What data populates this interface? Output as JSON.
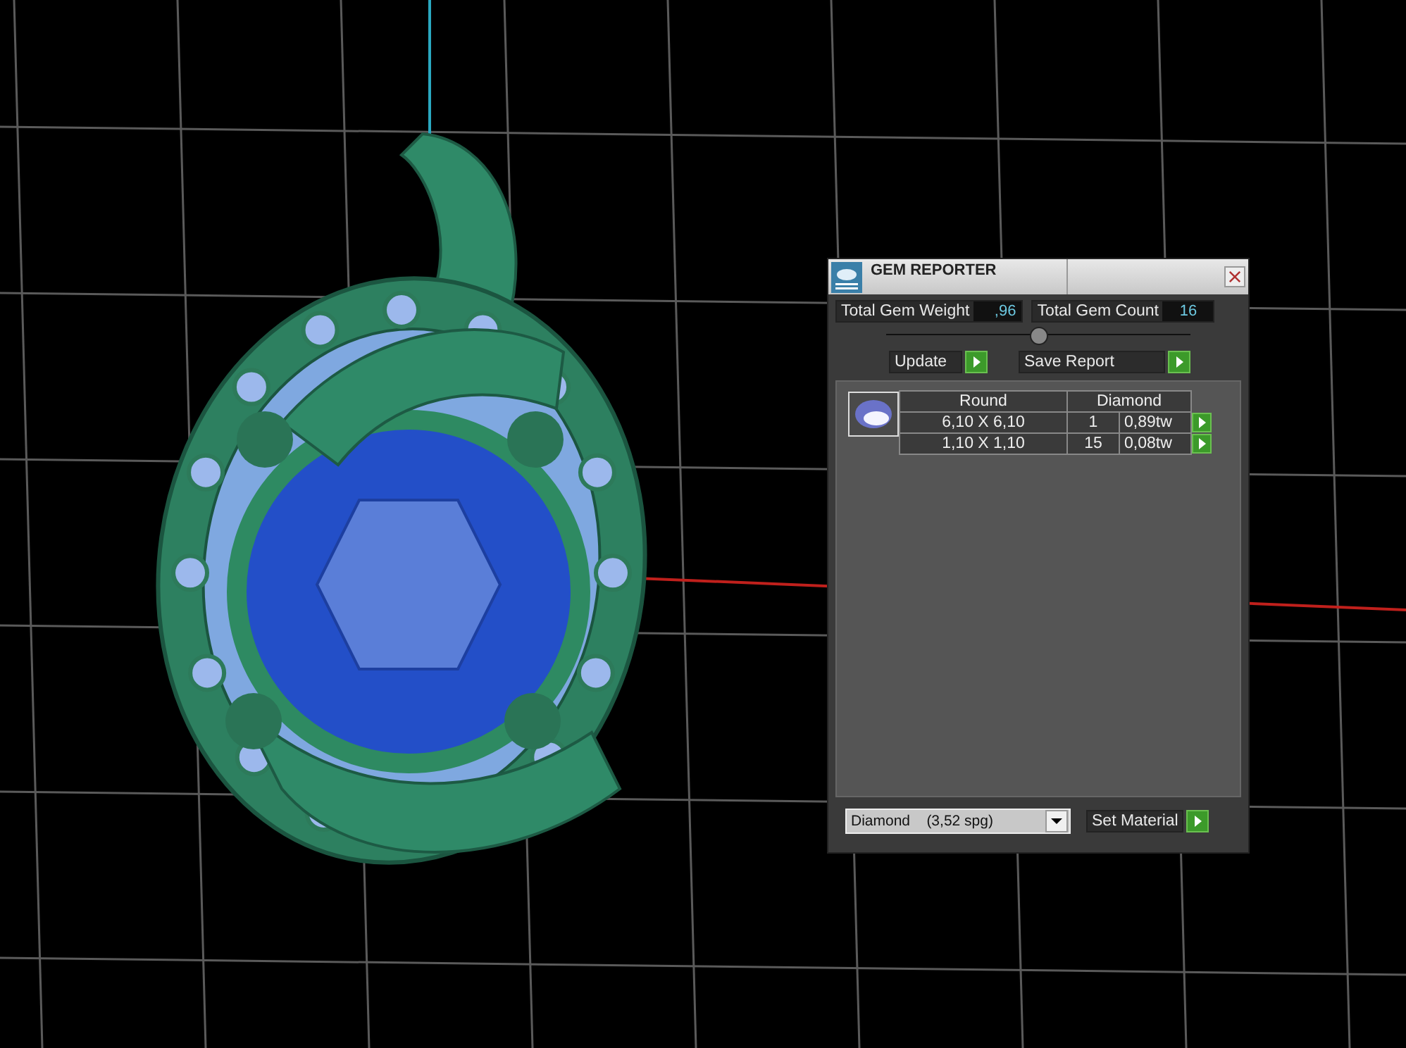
{
  "window": {
    "title": "GEM REPORTER"
  },
  "totals": [
    {
      "label": "Total Gem Weight",
      "value": ",96"
    },
    {
      "label": "Total Gem Count",
      "value": "16"
    }
  ],
  "buttons": [
    "Update",
    "Save Report"
  ],
  "gem_table": {
    "columns": [
      "Round",
      "Diamond"
    ],
    "rows": [
      {
        "size": "6,10 X 6,10",
        "count": "1",
        "weight": "0,89tw"
      },
      {
        "size": "1,10 X 1,10",
        "count": "15",
        "weight": "0,08tw"
      }
    ]
  },
  "material": {
    "value": "Diamond    (3,52 spg)",
    "button": "Set Material"
  }
}
